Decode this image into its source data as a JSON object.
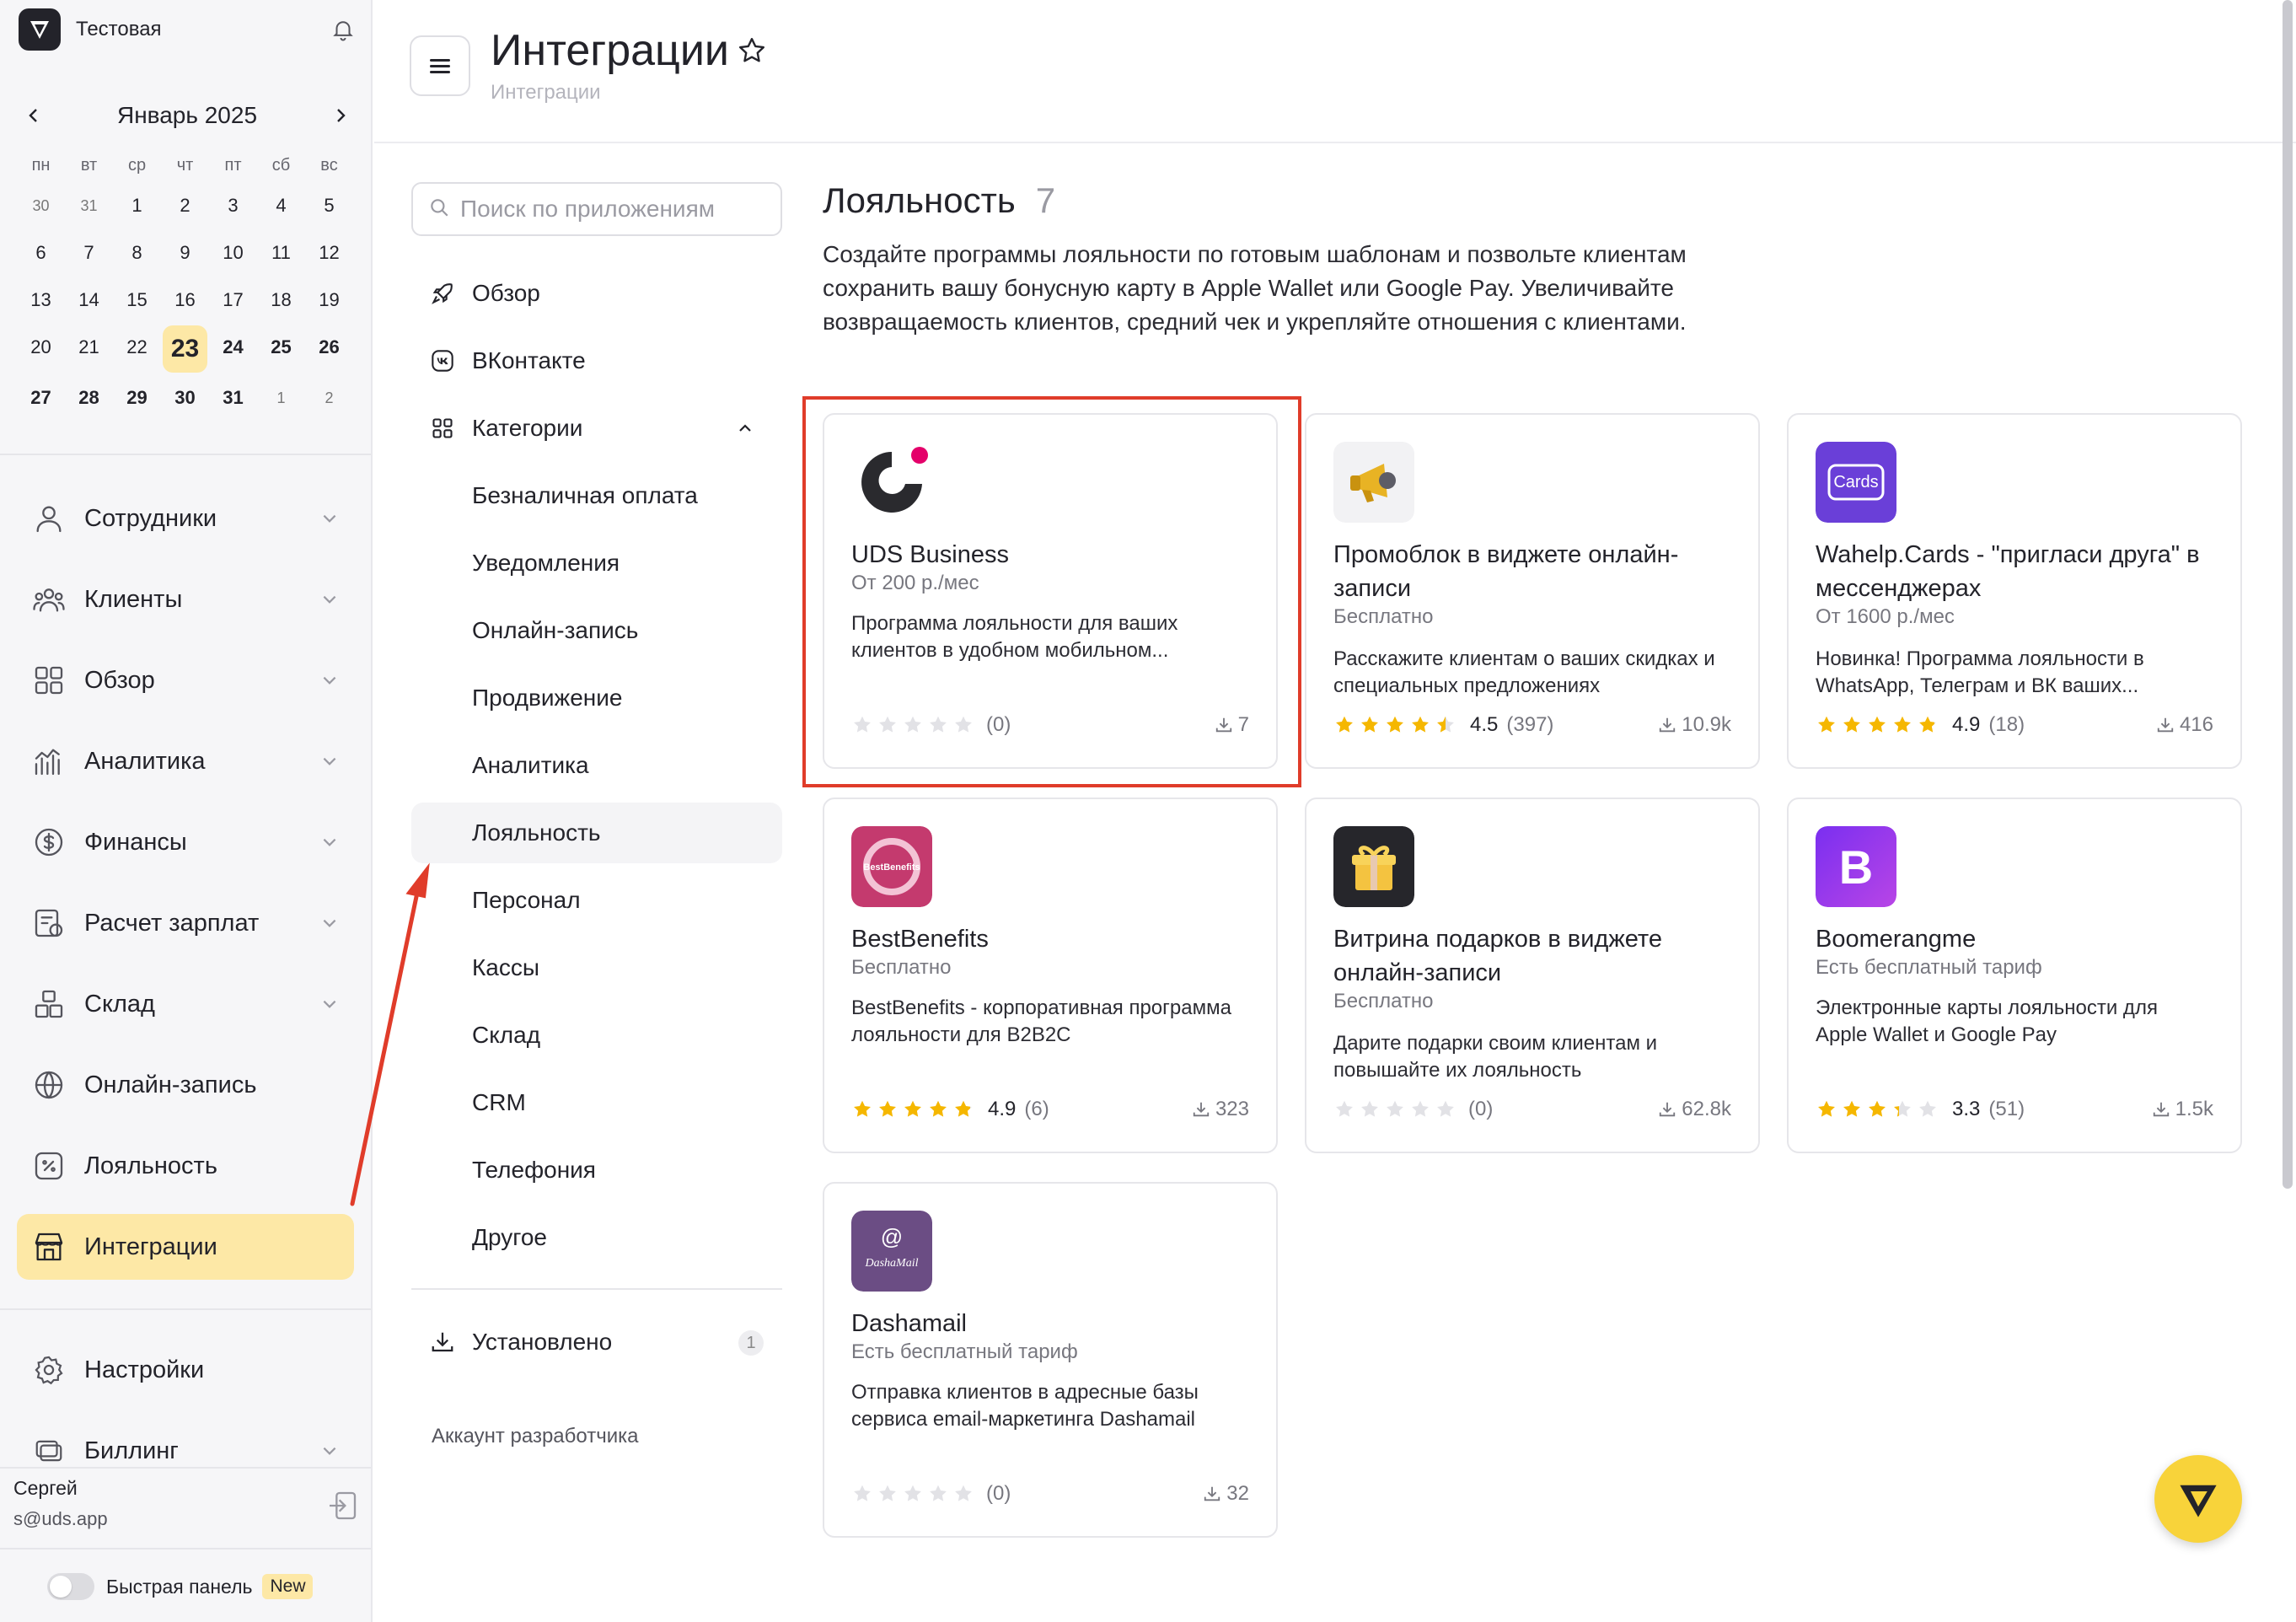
{
  "brand": {
    "name": "Тестовая"
  },
  "calendar": {
    "month_label": "Январь 2025",
    "weekdays": [
      "пн",
      "вт",
      "ср",
      "чт",
      "пт",
      "сб",
      "вс"
    ],
    "days": [
      "30",
      "31",
      "1",
      "2",
      "3",
      "4",
      "5",
      "6",
      "7",
      "8",
      "9",
      "10",
      "11",
      "12",
      "13",
      "14",
      "15",
      "16",
      "17",
      "18",
      "19",
      "20",
      "21",
      "22",
      "23",
      "24",
      "25",
      "26",
      "27",
      "28",
      "29",
      "30",
      "31",
      "1",
      "2"
    ],
    "today": "23"
  },
  "nav": {
    "items": [
      {
        "label": "Сотрудники",
        "icon": "user-icon"
      },
      {
        "label": "Клиенты",
        "icon": "users-icon"
      },
      {
        "label": "Обзор",
        "icon": "grid-icon"
      },
      {
        "label": "Аналитика",
        "icon": "analytics-icon"
      },
      {
        "label": "Финансы",
        "icon": "dollar-icon"
      },
      {
        "label": "Расчет зарплат",
        "icon": "payroll-icon"
      },
      {
        "label": "Склад",
        "icon": "boxes-icon"
      },
      {
        "label": "Онлайн-запись",
        "icon": "globe-icon"
      },
      {
        "label": "Лояльность",
        "icon": "percent-icon"
      },
      {
        "label": "Интеграции",
        "icon": "store-icon"
      }
    ],
    "settings": "Настройки",
    "billing": "Биллинг"
  },
  "user": {
    "name": "Сергей",
    "email": "s@uds.app"
  },
  "quick_panel": {
    "label": "Быстрая панель",
    "badge": "New"
  },
  "header": {
    "title": "Интеграции",
    "breadcrumb": "Интеграции"
  },
  "search": {
    "placeholder": "Поиск по приложениям"
  },
  "categories": {
    "overview": "Обзор",
    "vk": "ВКонтакте",
    "categories_label": "Категории",
    "sub": [
      "Безналичная оплата",
      "Уведомления",
      "Онлайн-запись",
      "Продвижение",
      "Аналитика",
      "Лояльность",
      "Персонал",
      "Кассы",
      "Склад",
      "CRM",
      "Телефония",
      "Другое"
    ],
    "active_sub": "Лояльность",
    "installed": "Установлено",
    "installed_count": "1",
    "dev_account": "Аккаунт разработчика"
  },
  "section": {
    "title": "Лояльность",
    "count": "7",
    "description": "Создайте программы лояльности по готовым шаблонам и позвольте клиентам сохранить вашу бонусную карту в Apple Wallet или Google Pay. Увеличивайте возвращаемость клиентов, средний чек и укрепляйте отношения с клиентами."
  },
  "apps": [
    {
      "name": "UDS Business",
      "price": "От 200 р./мес",
      "description": "Программа лояльности для ваших клиентов в удобном мобильном...",
      "rating": 0,
      "rating_text": "",
      "reviews": "(0)",
      "downloads": "7",
      "logo": "uds-logo"
    },
    {
      "name": "Промоблок в виджете онлайн-записи",
      "price": "Бесплатно",
      "description": "Расскажите клиентам о ваших скидках и специальных предложениях",
      "rating": 4.5,
      "rating_text": "4.5",
      "reviews": "(397)",
      "downloads": "10.9k",
      "logo": "megaphone-logo"
    },
    {
      "name": "Wahelp.Cards - \"пригласи друга\" в мессенджерах",
      "price": "От 1600 р./мес",
      "description": "Новинка! Программа лояльности в WhatsApp, Телеграм и ВК ваших...",
      "rating": 4.9,
      "rating_text": "4.9",
      "reviews": "(18)",
      "downloads": "416",
      "logo": "cards-logo",
      "logo_text": "Cards"
    },
    {
      "name": "BestBenefits",
      "price": "Бесплатно",
      "description": "BestBenefits - корпоративная программа лояльности для B2B2C",
      "rating": 4.9,
      "rating_text": "4.9",
      "reviews": "(6)",
      "downloads": "323",
      "logo": "bestbenefits-logo",
      "logo_text": "BestBenefits"
    },
    {
      "name": "Витрина подарков в виджете онлайн-записи",
      "price": "Бесплатно",
      "description": "Дарите подарки своим клиентам и повышайте их лояльность",
      "rating": 0,
      "rating_text": "",
      "reviews": "(0)",
      "downloads": "62.8k",
      "logo": "gift-logo"
    },
    {
      "name": "Boomerangme",
      "price": "Есть бесплатный тариф",
      "description": "Электронные карты лояльности для Apple Wallet и Google Pay",
      "rating": 3.3,
      "rating_text": "3.3",
      "reviews": "(51)",
      "downloads": "1.5k",
      "logo": "boomerangme-logo",
      "logo_text": "B"
    },
    {
      "name": "Dashamail",
      "price": "Есть бесплатный тариф",
      "description": "Отправка клиентов в адресные базы сервиса email-маркетинга Dashamail",
      "rating": 0,
      "rating_text": "",
      "reviews": "(0)",
      "downloads": "32",
      "logo": "dashamail-logo",
      "logo_text": "DashaMail"
    }
  ],
  "colors": {
    "accent": "#f8d33a",
    "active_bg": "#fde8a6",
    "highlight": "#e03c2a",
    "star": "#f5b700",
    "star_empty": "#e2e2e6"
  }
}
